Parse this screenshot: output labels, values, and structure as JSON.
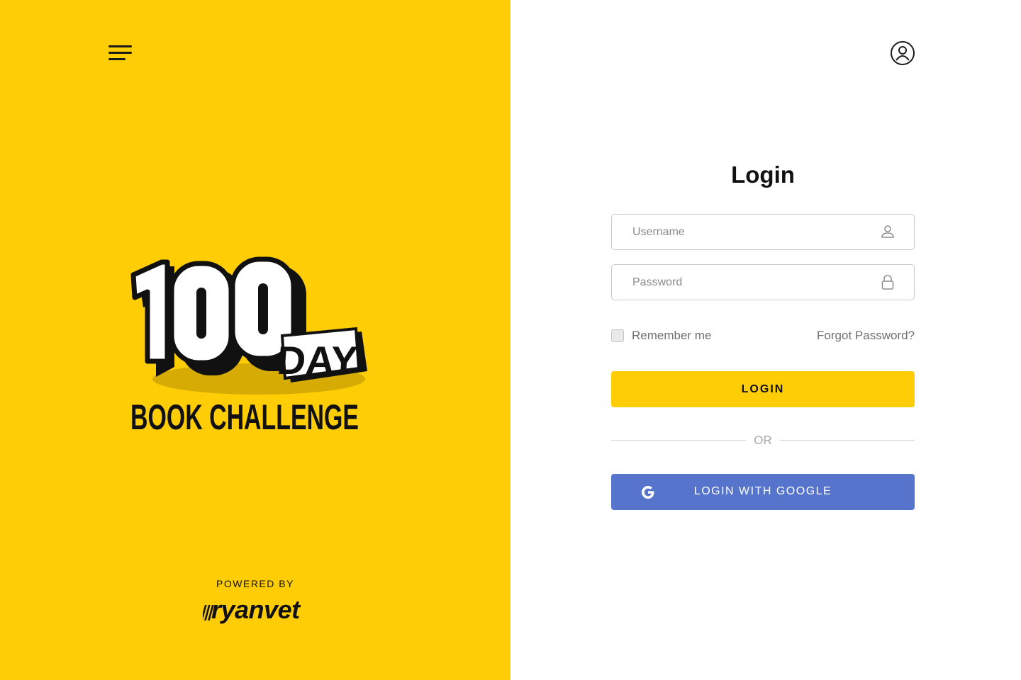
{
  "colors": {
    "brand_yellow": "#FECD06",
    "google_blue": "#5674CC",
    "text_dark": "#111111",
    "text_muted": "#707070"
  },
  "left_panel": {
    "menu_icon": "hamburger-menu-icon",
    "logo": {
      "number": "100",
      "day": "DAY",
      "subtitle": "BOOK CHALLENGE"
    },
    "powered_by": "POWERED BY",
    "brand_name": "ryanvet"
  },
  "header": {
    "account_icon": "user-account-icon"
  },
  "login_form": {
    "title": "Login",
    "username": {
      "placeholder": "Username",
      "value": "",
      "icon": "user-icon"
    },
    "password": {
      "placeholder": "Password",
      "value": "",
      "icon": "lock-icon"
    },
    "remember_me": {
      "label": "Remember me",
      "checked": false
    },
    "forgot_password": "Forgot Password?",
    "login_button": "LOGIN",
    "divider_text": "OR",
    "google_button": {
      "label": "LOGIN WITH GOOGLE",
      "icon": "google-icon"
    }
  }
}
